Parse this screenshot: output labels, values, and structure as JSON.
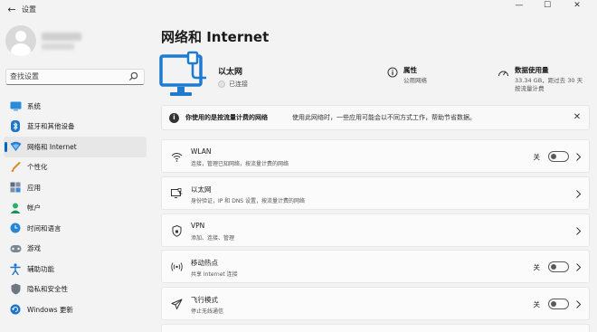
{
  "window": {
    "title": "设置",
    "back_glyph": "←",
    "min_glyph": "—",
    "max_glyph": "☐",
    "close_glyph": "✕"
  },
  "sidebar": {
    "search_placeholder": "查找设置",
    "items": [
      {
        "label": "系统",
        "icon": "system-icon",
        "active": false
      },
      {
        "label": "蓝牙和其他设备",
        "icon": "bluetooth-icon",
        "active": false
      },
      {
        "label": "网络和 Internet",
        "icon": "network-icon",
        "active": true
      },
      {
        "label": "个性化",
        "icon": "personalization-icon",
        "active": false
      },
      {
        "label": "应用",
        "icon": "apps-icon",
        "active": false
      },
      {
        "label": "帐户",
        "icon": "account-icon",
        "active": false
      },
      {
        "label": "时间和语言",
        "icon": "time-language-icon",
        "active": false
      },
      {
        "label": "游戏",
        "icon": "gaming-icon",
        "active": false
      },
      {
        "label": "辅助功能",
        "icon": "accessibility-icon",
        "active": false
      },
      {
        "label": "隐私和安全性",
        "icon": "privacy-icon",
        "active": false
      },
      {
        "label": "Windows 更新",
        "icon": "windows-update-icon",
        "active": false
      }
    ]
  },
  "main": {
    "title": "网络和 Internet",
    "ethernet": {
      "name": "以太网",
      "status": "已连接"
    },
    "properties": {
      "title": "属性",
      "subtitle": "公用网络"
    },
    "data_usage": {
      "title": "数据使用量",
      "line1": "33.34 GB，距过去 30 天",
      "line2": "按流量计费"
    },
    "banner": {
      "title": "你使用的是按流量计费的网络",
      "detail": "使用此网络时，一些应用可能会以不同方式工作，帮助节省数据。",
      "close_glyph": "✕"
    },
    "cards": [
      {
        "title": "WLAN",
        "subtitle": "连接，管理已知网络，按流量计费的网络",
        "icon": "wifi-icon",
        "state": "关",
        "kind": "toggle-chevron"
      },
      {
        "title": "以太网",
        "subtitle": "身份验证，IP 和 DNS 设置，按流量计费的网络",
        "icon": "ethernet-icon",
        "kind": "chevron"
      },
      {
        "title": "VPN",
        "subtitle": "添加、连接、管理",
        "icon": "vpn-icon",
        "kind": "chevron"
      },
      {
        "title": "移动热点",
        "subtitle": "共享 Internet 连接",
        "icon": "hotspot-icon",
        "state": "关",
        "kind": "toggle-chevron"
      },
      {
        "title": "飞行模式",
        "subtitle": "停止无线通信",
        "icon": "airplane-icon",
        "state": "关",
        "kind": "toggle-chevron"
      }
    ]
  },
  "colors": {
    "accent": "#0067c0",
    "background": "#f3f3f3",
    "card": "#fbfbfb"
  }
}
